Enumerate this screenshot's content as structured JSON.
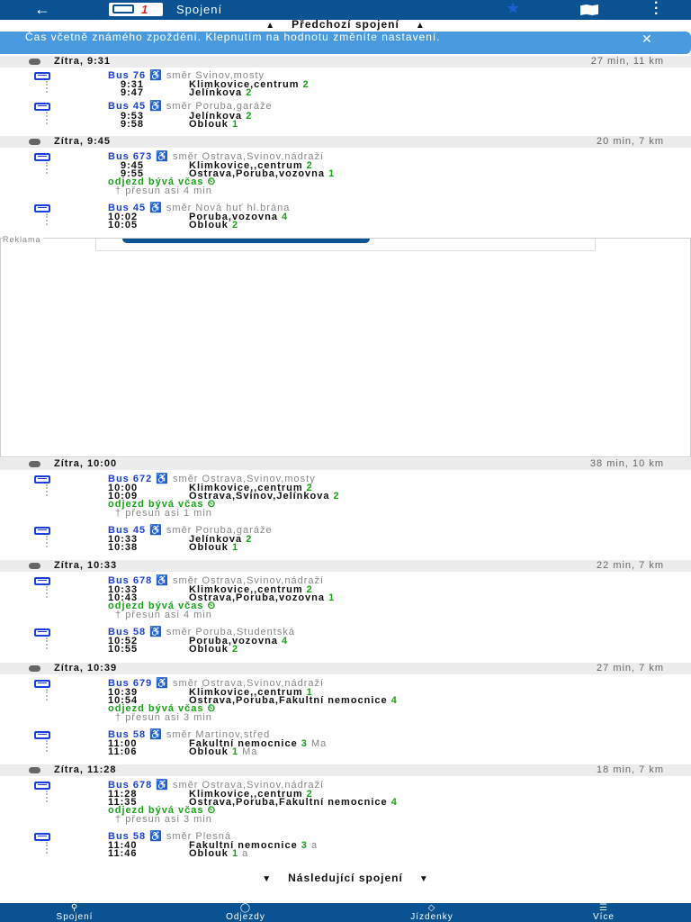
{
  "topbar": {
    "back_icon": "arrow-left-icon",
    "logo_text": "1",
    "title": "Spojení",
    "favorite_icon": "star-icon",
    "map_icon": "map-icon",
    "menu_icon": "vertical-dots-icon"
  },
  "previous": {
    "label": "Předchozí spojení"
  },
  "banner": {
    "text": "Čas včetně známého zpoždění. Klepnutím na hodnotu změníte nastavení.",
    "close_icon": "close-icon"
  },
  "ad": {
    "label": "Reklama"
  },
  "connections": [
    {
      "when": "Zítra, 9:31",
      "duration": "27 min, 11 km",
      "legs": [
        {
          "bus": "Bus 76",
          "dir": "směr Svinov,mosty",
          "dep_time": "9:31",
          "dep_stop": "Klimkovice,centrum",
          "dep_plat": "2",
          "arr_time": "9:47",
          "arr_stop": "Jelínkova",
          "arr_plat": "2"
        },
        {
          "bus": "Bus 45",
          "dir": "směr Poruba,garáže",
          "dep_time": "9:53",
          "dep_stop": "Jelínkova",
          "dep_plat": "2",
          "arr_time": "9:58",
          "arr_stop": "Oblouk",
          "arr_plat": "1"
        }
      ]
    },
    {
      "when": "Zítra, 9:45",
      "duration": "20 min, 7 km",
      "ontime": "odjezd bývá včas",
      "transfer": "přesun asi 4 min",
      "legs": [
        {
          "bus": "Bus 673",
          "dir": "směr Ostrava,Svinov,nádraží",
          "dep_time": "9:45",
          "dep_stop": "Klimkovice,,centrum",
          "dep_plat": "2",
          "arr_time": "9:55",
          "arr_stop": "Ostrava,Poruba,vozovna",
          "arr_plat": "1"
        },
        {
          "bus": "Bus 45",
          "dir": "směr Nová huť hl.brána",
          "dep_time": "10:02",
          "dep_stop": "Poruba,vozovna",
          "dep_plat": "4",
          "arr_time": "10:05",
          "arr_stop": "Oblouk",
          "arr_plat": "2"
        }
      ]
    },
    {
      "when": "Zítra, 10:00",
      "duration": "38 min, 10 km",
      "ontime": "odjezd bývá včas",
      "transfer": "přesun asi 1 min",
      "legs": [
        {
          "bus": "Bus 672",
          "dir": "směr Ostrava,Svinov,mosty",
          "dep_time": "10:00",
          "dep_stop": "Klimkovice,,centrum",
          "dep_plat": "2",
          "arr_time": "10:09",
          "arr_stop": "Ostrava,Svinov,Jelínkova",
          "arr_plat": "2"
        },
        {
          "bus": "Bus 45",
          "dir": "směr Poruba,garáže",
          "dep_time": "10:33",
          "dep_stop": "Jelínkova",
          "dep_plat": "2",
          "arr_time": "10:38",
          "arr_stop": "Oblouk",
          "arr_plat": "1"
        }
      ]
    },
    {
      "when": "Zítra, 10:33",
      "duration": "22 min, 7 km",
      "ontime": "odjezd bývá včas",
      "transfer": "přesun asi 4 min",
      "legs": [
        {
          "bus": "Bus 678",
          "dir": "směr Ostrava,Svinov,nádraží",
          "dep_time": "10:33",
          "dep_stop": "Klimkovice,,centrum",
          "dep_plat": "2",
          "arr_time": "10:43",
          "arr_stop": "Ostrava,Poruba,vozovna",
          "arr_plat": "1"
        },
        {
          "bus": "Bus 58",
          "dir": "směr Poruba,Studentská",
          "dep_time": "10:52",
          "dep_stop": "Poruba,vozovna",
          "dep_plat": "4",
          "arr_time": "10:55",
          "arr_stop": "Oblouk",
          "arr_plat": "2"
        }
      ]
    },
    {
      "when": "Zítra, 10:39",
      "duration": "27 min, 7 km",
      "ontime": "odjezd bývá včas",
      "transfer": "přesun asi 3 min",
      "legs": [
        {
          "bus": "Bus 679",
          "dir": "směr Ostrava,Svinov,nádraží",
          "dep_time": "10:39",
          "dep_stop": "Klimkovice,,centrum",
          "dep_plat": "1",
          "arr_time": "10:54",
          "arr_stop": "Ostrava,Poruba,Fakultní nemocnice",
          "arr_plat": "4"
        },
        {
          "bus": "Bus 58",
          "dir": "směr Martinov,střed",
          "dep_time": "11:00",
          "dep_stop": "Fakultní nemocnice",
          "dep_plat": "3",
          "dep_extra": "Ma",
          "arr_time": "11:06",
          "arr_stop": "Oblouk",
          "arr_plat": "1",
          "arr_extra": "Ma"
        }
      ]
    },
    {
      "when": "Zítra, 11:28",
      "duration": "18 min, 7 km",
      "ontime": "odjezd bývá včas",
      "transfer": "přesun asi 3 min",
      "legs": [
        {
          "bus": "Bus 678",
          "dir": "směr Ostrava,Svinov,nádraží",
          "dep_time": "11:28",
          "dep_stop": "Klimkovice,,centrum",
          "dep_plat": "2",
          "arr_time": "11:35",
          "arr_stop": "Ostrava,Poruba,Fakultní nemocnice",
          "arr_plat": "4"
        },
        {
          "bus": "Bus 58",
          "dir": "směr Plesná",
          "dep_time": "11:40",
          "dep_stop": "Fakultní nemocnice",
          "dep_plat": "3",
          "dep_extra": "a",
          "arr_time": "11:46",
          "arr_stop": "Oblouk",
          "arr_plat": "1",
          "arr_extra": "a"
        }
      ]
    }
  ],
  "next": {
    "label": "Následující spojení"
  },
  "nav": [
    {
      "label": "Spojení",
      "icon": "search-icon"
    },
    {
      "label": "Odjezdy",
      "icon": "departures-icon"
    },
    {
      "label": "Jízdenky",
      "icon": "ticket-icon"
    },
    {
      "label": "Více",
      "icon": "menu-icon"
    }
  ],
  "colors": {
    "primary": "#0a5291",
    "bus_blue": "#1a3fe0",
    "platform_green": "#1aa31a",
    "banner": "#4a9ae0"
  }
}
